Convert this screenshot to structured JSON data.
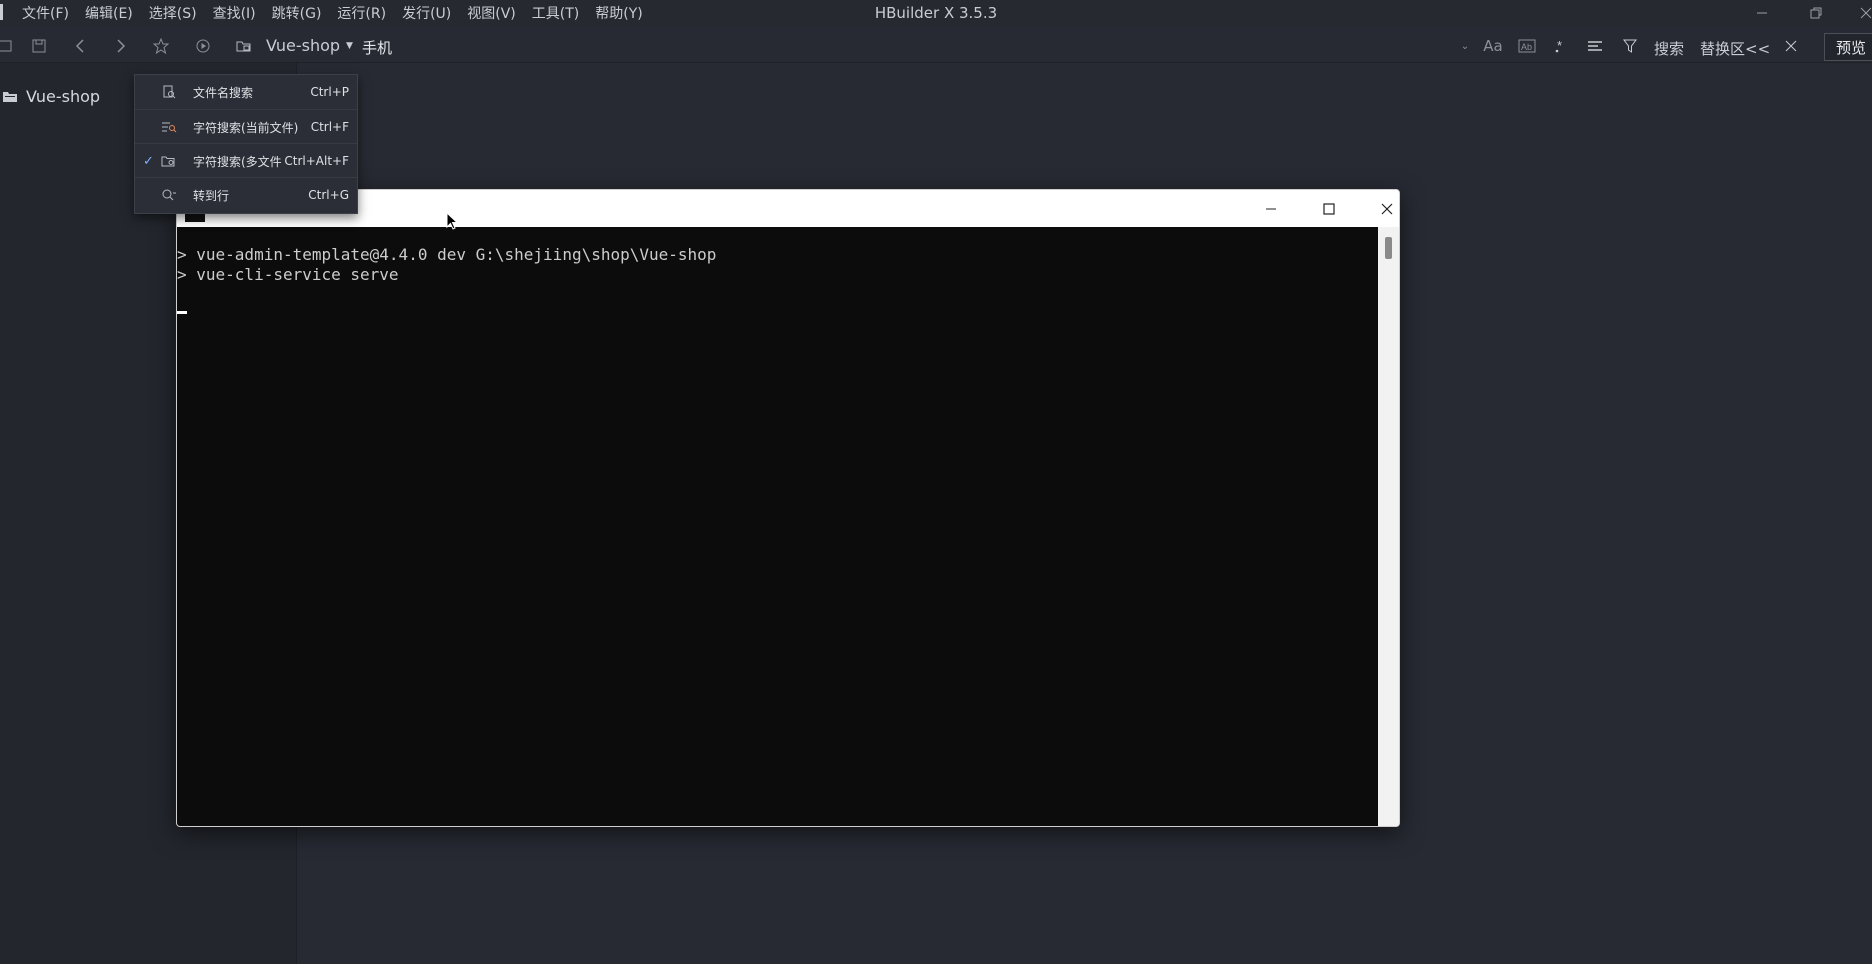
{
  "app": {
    "title": "HBuilder X 3.5.3",
    "menu": [
      "文件(F)",
      "编辑(E)",
      "选择(S)",
      "查找(I)",
      "跳转(G)",
      "运行(R)",
      "发行(U)",
      "视图(V)",
      "工具(T)",
      "帮助(Y)"
    ]
  },
  "toolbar": {
    "project": "Vue-shop",
    "device": "手机",
    "search_label": "搜索",
    "replace_label": "替换区<<",
    "preview_label": "预览"
  },
  "sidebar": {
    "items": [
      {
        "label": "Vue-shop"
      }
    ]
  },
  "find_menu": {
    "items": [
      {
        "label": "文件名搜索",
        "shortcut": "Ctrl+P",
        "checked": false,
        "icon": "file-search-icon"
      },
      {
        "label": "字符搜索(当前文件)",
        "shortcut": "Ctrl+F",
        "checked": false,
        "icon": "text-search-icon"
      },
      {
        "label": "字符搜索(多文件",
        "shortcut": "Ctrl+Alt+F",
        "checked": true,
        "icon": "multi-file-search-icon"
      },
      {
        "label": "转到行",
        "shortcut": "Ctrl+G",
        "checked": false,
        "icon": "goto-line-icon"
      }
    ]
  },
  "terminal": {
    "lines": [
      "> vue-admin-template@4.4.0 dev G:\\shejiing\\shop\\Vue-shop",
      "> vue-cli-service serve"
    ]
  }
}
